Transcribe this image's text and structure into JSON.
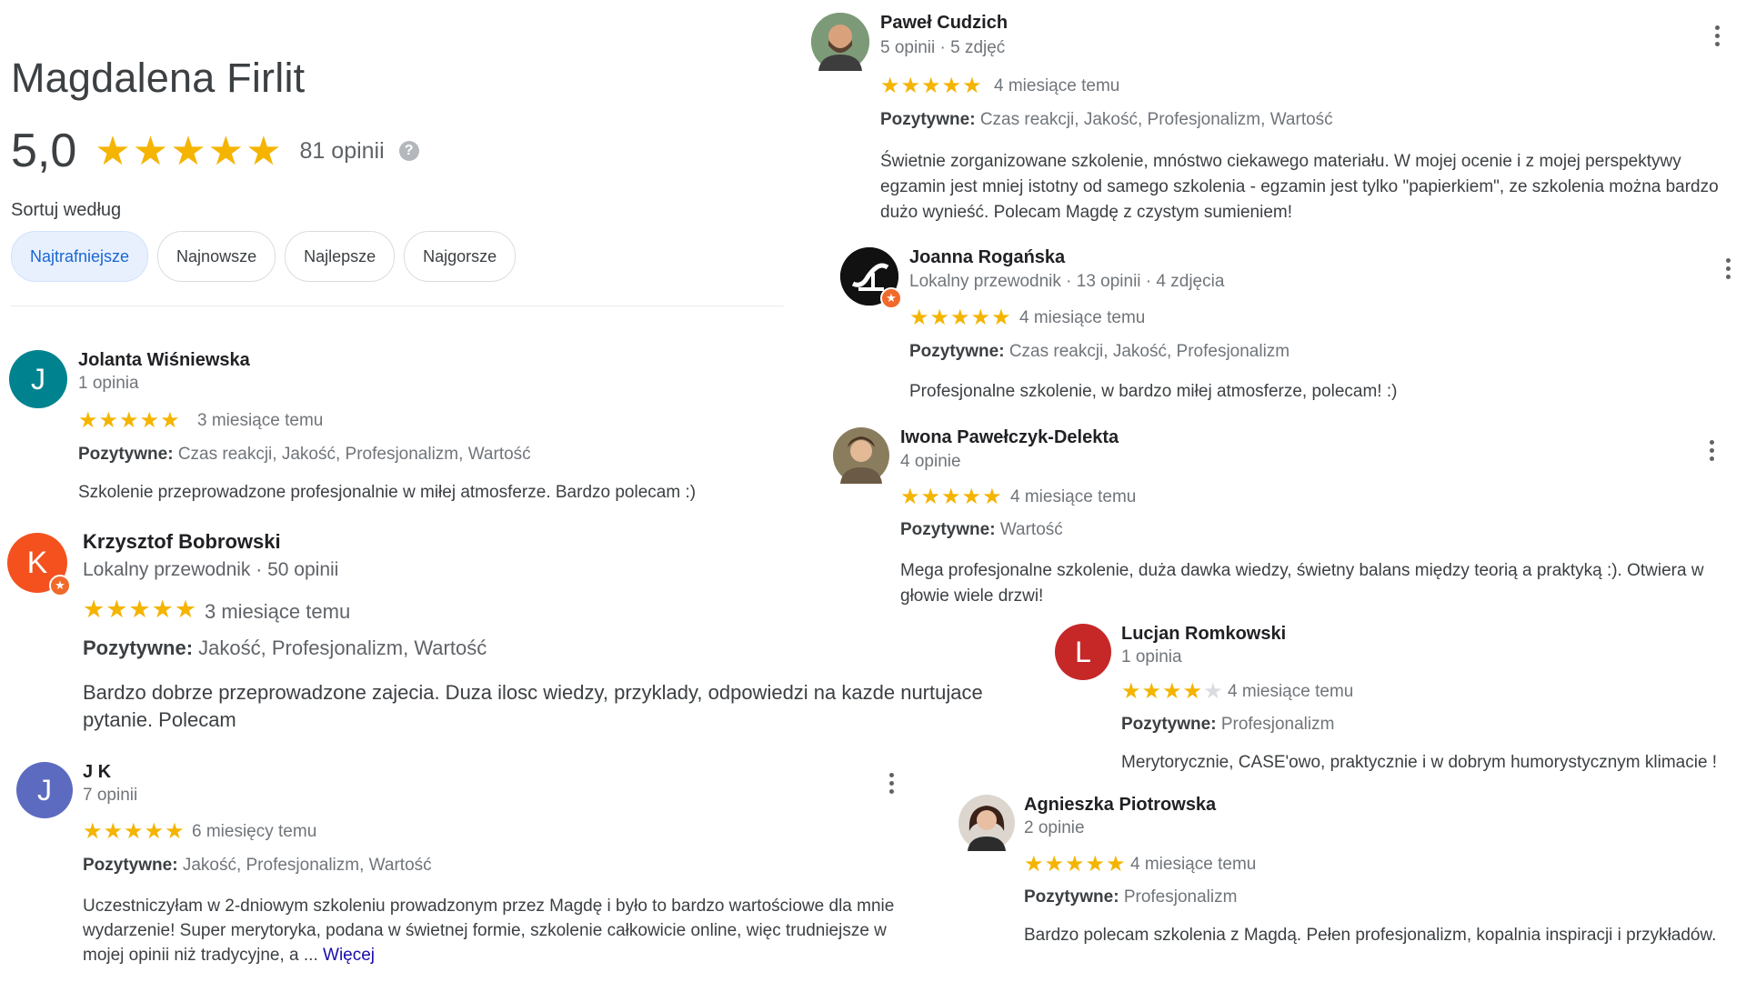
{
  "place": {
    "title": "Magdalena Firlit",
    "rating": "5,0",
    "stars": "★★★★★",
    "reviews_count": "81 opinii",
    "help_icon": "?"
  },
  "sort": {
    "label": "Sortuj według",
    "options": [
      "Najtrafniejsze",
      "Najnowsze",
      "Najlepsze",
      "Najgorsze"
    ],
    "selected": "Najtrafniejsze"
  },
  "colors": {
    "star": "#f4b400",
    "link": "#1a0dab",
    "chip_active_bg": "#e8f0fe"
  },
  "reviews": [
    {
      "name": "Jolanta Wiśniewska",
      "initial": "J",
      "avatar_color": "#00838f",
      "meta": "1 opinia",
      "rating": 5,
      "stars": "★★★★★",
      "time": "3 miesiące temu",
      "positives_label": "Pozytywne:",
      "positives": "Czas reakcji, Jakość, Profesjonalizm, Wartość",
      "text": "Szkolenie przeprowadzone profesjonalnie w miłej atmosferze. Bardzo polecam :)"
    },
    {
      "name": "Krzysztof Bobrowski",
      "initial": "K",
      "avatar_color": "#f4511e",
      "local_guide": true,
      "meta": "Lokalny przewodnik · 50 opinii",
      "rating": 5,
      "stars": "★★★★★",
      "time": "3 miesiące temu",
      "positives_label": "Pozytywne:",
      "positives": "Jakość, Profesjonalizm, Wartość",
      "text": "Bardzo dobrze przeprowadzone zajecia. Duza ilosc wiedzy, przyklady, odpowiedzi na kazde nurtujace pytanie. Polecam"
    },
    {
      "name": "J K",
      "initial": "J",
      "avatar_color": "#5c6bc0",
      "meta": "7 opinii",
      "rating": 5,
      "stars": "★★★★★",
      "time": "6 miesięcy temu",
      "positives_label": "Pozytywne:",
      "positives": "Jakość, Profesjonalizm, Wartość",
      "text": "Uczestniczyłam w 2-dniowym szkoleniu prowadzonym przez Magdę i było to bardzo wartościowe dla mnie wydarzenie! Super merytoryka, podana w świetnej formie, szkolenie całkowicie online, więc trudniejsze w mojej opinii niż tradycyjne, a ...",
      "more": "Więcej"
    },
    {
      "name": "Paweł Cudzich",
      "avatar_icon": "user-photo-icon",
      "meta": "5 opinii · 5 zdjęć",
      "rating": 5,
      "stars": "★★★★★",
      "time": "4 miesiące temu",
      "positives_label": "Pozytywne:",
      "positives": "Czas reakcji, Jakość, Profesjonalizm, Wartość",
      "text": "Świetnie zorganizowane szkolenie, mnóstwo ciekawego materiału. W mojej ocenie i z mojej perspektywy egzamin jest mniej istotny od samego szkolenia - egzamin jest tylko \"papierkiem\", ze szkolenia można bardzo dużo wynieść. Polecam Magdę z czystym sumieniem!"
    },
    {
      "name": "Joanna Rogańska",
      "avatar_icon": "logo-avatar-icon",
      "local_guide": true,
      "meta": "Lokalny przewodnik · 13 opinii · 4 zdjęcia",
      "rating": 5,
      "stars": "★★★★★",
      "time": "4 miesiące temu",
      "positives_label": "Pozytywne:",
      "positives": "Czas reakcji, Jakość, Profesjonalizm",
      "text": "Profesjonalne szkolenie, w bardzo miłej atmosferze, polecam! :)"
    },
    {
      "name": "Iwona Pawełczyk-Delekta",
      "avatar_icon": "user-photo-icon",
      "meta": "4 opinie",
      "rating": 5,
      "stars": "★★★★★",
      "time": "4 miesiące temu",
      "positives_label": "Pozytywne:",
      "positives": "Wartość",
      "text": "Mega profesjonalne szkolenie, duża dawka wiedzy, świetny balans między teorią a praktyką :). Otwiera w głowie wiele drzwi!"
    },
    {
      "name": "Lucjan Romkowski",
      "initial": "L",
      "avatar_color": "#c62828",
      "meta": "1 opinia",
      "rating": 4,
      "stars_on": "★★★★",
      "stars_off": "★",
      "time": "4 miesiące temu",
      "positives_label": "Pozytywne:",
      "positives": "Profesjonalizm",
      "text": "Merytorycznie, CASE'owo, praktycznie i w dobrym humorystycznym klimacie !"
    },
    {
      "name": "Agnieszka Piotrowska",
      "avatar_icon": "user-photo-icon",
      "meta": "2 opinie",
      "rating": 5,
      "stars": "★★★★★",
      "time": "4 miesiące temu",
      "positives_label": "Pozytywne:",
      "positives": "Profesjonalizm",
      "text": "Bardzo polecam szkolenia z Magdą. Pełen profesjonalizm, kopalnia inspiracji i przykładów."
    }
  ]
}
